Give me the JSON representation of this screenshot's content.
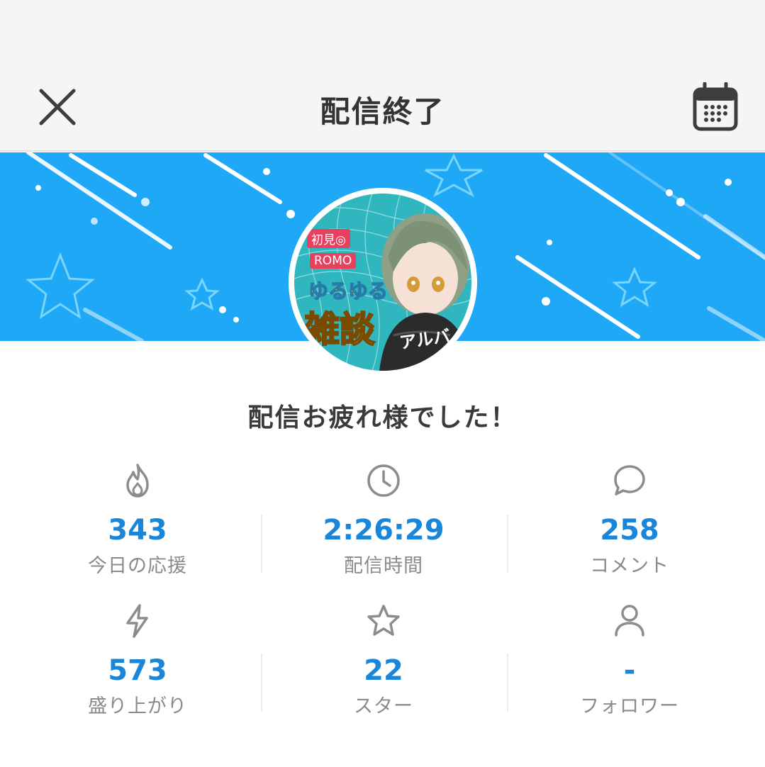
{
  "header": {
    "title": "配信終了",
    "close_icon": "close-icon",
    "calendar_icon": "calendar-icon"
  },
  "banner": {
    "color": "#1fa8f5"
  },
  "avatar": {
    "badge_1": "初見◎",
    "badge_2": "ROMO",
    "title_1": "ゆるゆる",
    "title_2": "雑談",
    "name": "アルバ"
  },
  "message": "配信お疲れ様でした！",
  "stats": [
    {
      "icon": "flame-icon",
      "value": "343",
      "label": "今日の応援"
    },
    {
      "icon": "clock-icon",
      "value": "2:26:29",
      "label": "配信時間"
    },
    {
      "icon": "comment-icon",
      "value": "258",
      "label": "コメント"
    },
    {
      "icon": "lightning-icon",
      "value": "573",
      "label": "盛り上がり"
    },
    {
      "icon": "star-icon",
      "value": "22",
      "label": "スター"
    },
    {
      "icon": "person-icon",
      "value": "-",
      "label": "フォロワー"
    }
  ],
  "colors": {
    "accent": "#1a86d9",
    "label": "#8a8a8a",
    "title": "#333333"
  }
}
